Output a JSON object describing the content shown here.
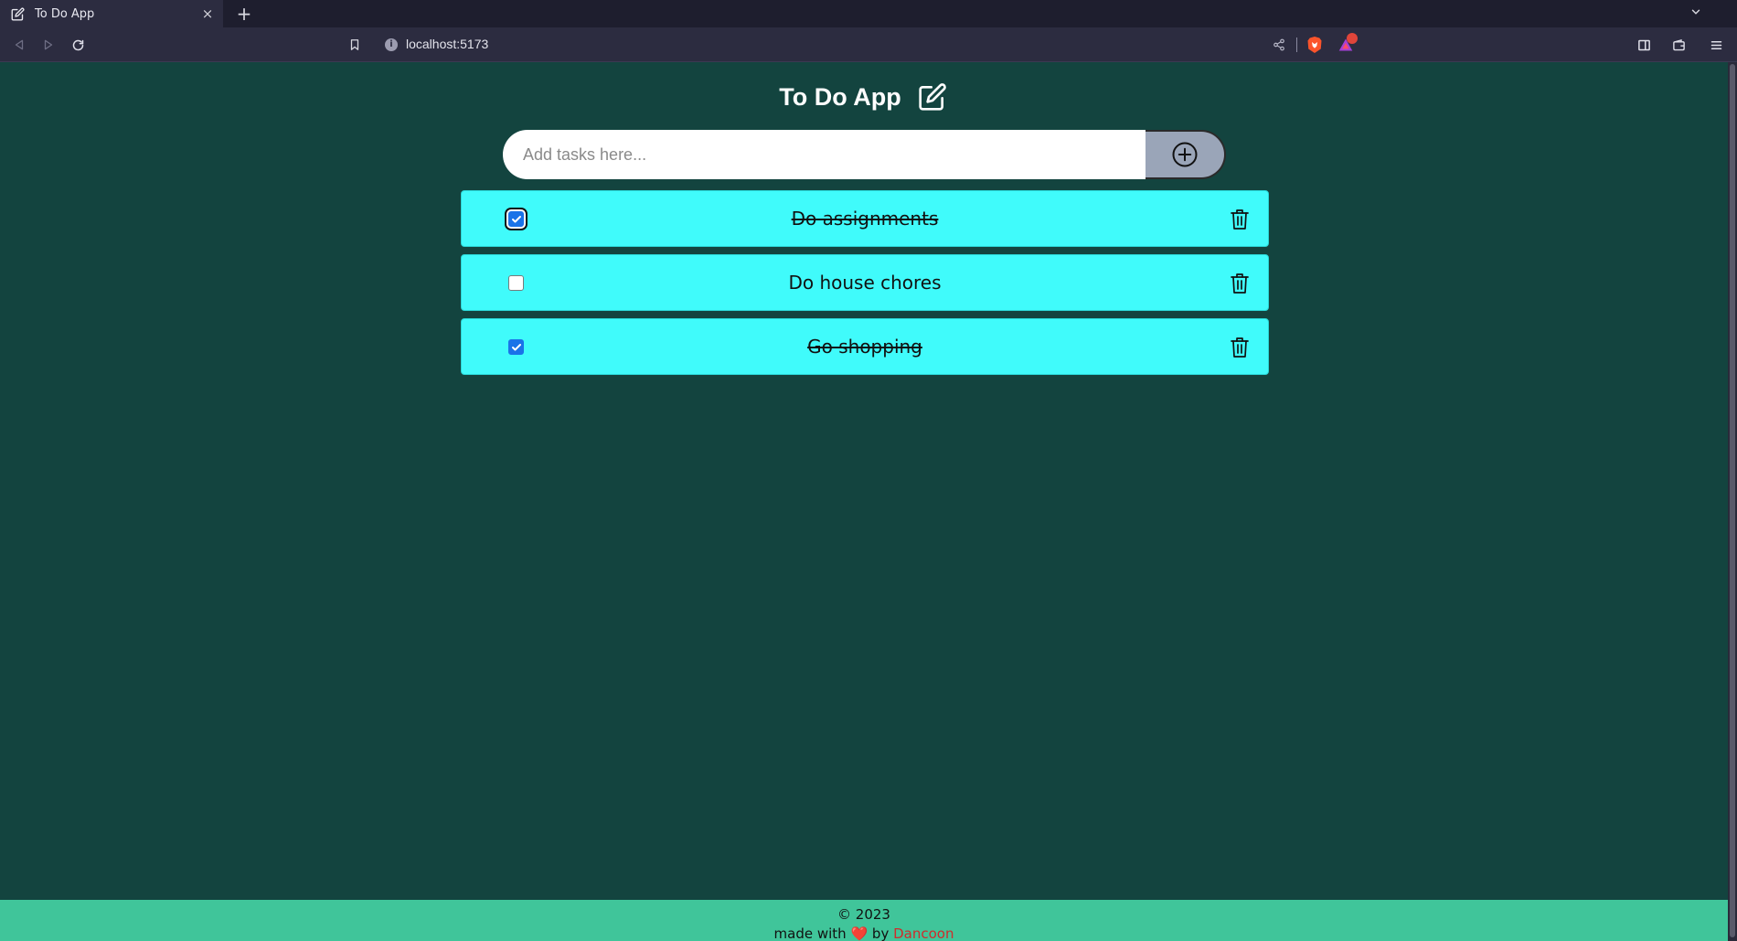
{
  "browser": {
    "tab_title": "To Do App",
    "tab_close": "×",
    "new_tab": "+",
    "tab_list": "⌄",
    "url": "localhost:5173",
    "info": "i"
  },
  "app": {
    "title": "To Do App",
    "input_placeholder": "Add tasks here...",
    "input_value": ""
  },
  "tasks": [
    {
      "label": "Do assignments",
      "done": true,
      "focused": true
    },
    {
      "label": "Do house chores",
      "done": false,
      "focused": false
    },
    {
      "label": "Go shopping",
      "done": true,
      "focused": false
    }
  ],
  "footer": {
    "copyright": "© 2023",
    "made_with": "made with",
    "heart": "❤️",
    "by": "by",
    "author": "Dancoon"
  },
  "colors": {
    "page_bg": "#13443f",
    "task_bg": "#40fbfb",
    "footer_bg": "#40c59a",
    "add_button_bg": "#9aa5b8",
    "author": "#d12b2b"
  }
}
